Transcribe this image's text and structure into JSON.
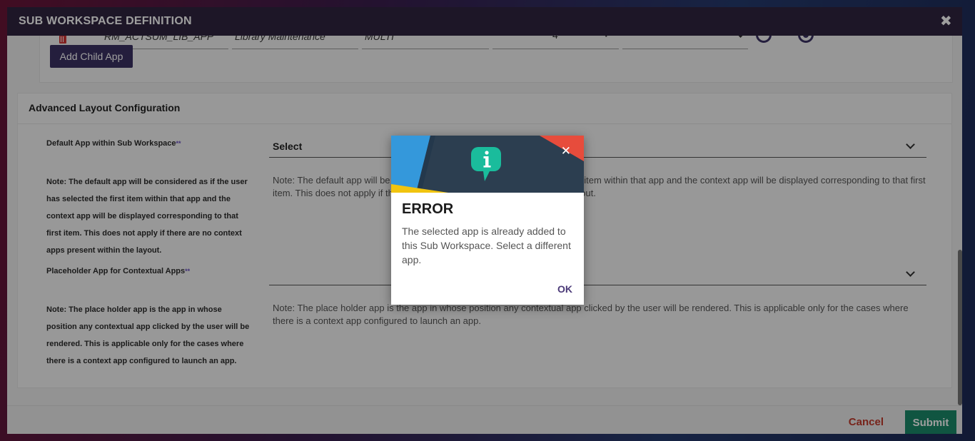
{
  "modal": {
    "title": "SUB WORKSPACE DEFINITION",
    "close_glyph": "✖"
  },
  "child_app_row": {
    "app_code": "RM_ACTSUM_LIB_APP",
    "app_name": "Library Maintenance",
    "mode": "MULTI",
    "minus": "−",
    "count": "4",
    "plus": "+"
  },
  "add_child_label": "Add Child App",
  "advanced": {
    "title": "Advanced Layout Configuration",
    "default_app_label": "Default App within Sub Workspace",
    "required_mark": "**",
    "default_app_side_note": "Note: The default app will be considered as if the user has selected the first item within that app and the context app will be displayed corresponding to that first item. This does not apply if there are no context apps present within the layout.",
    "default_app_select_value": "Select",
    "default_app_note": "Note: The default app will be considered as if the user has selected the first item within that app and the context app will be displayed corresponding to that first item. This does not apply if there are no context apps present within the layout.",
    "placeholder_label": "Placeholder App for Contextual Apps",
    "placeholder_side_note": "Note: The place holder app is the app in whose position any contextual app clicked by the user will be rendered. This is applicable only for the cases where there is a context app configured to launch an app.",
    "placeholder_select_value": "",
    "placeholder_note": "Note: The place holder app is the app in whose position any contextual app clicked by the user will be rendered. This is applicable only for the cases where there is a context app configured to launch an app."
  },
  "footer": {
    "cancel_label": "Cancel",
    "submit_label": "Submit"
  },
  "dialog": {
    "title": "ERROR",
    "message": "The selected app is already added to this Sub Workspace. Select a different app.",
    "ok_label": "OK",
    "close_glyph": "✕",
    "icon": "info-chat-icon",
    "colors": {
      "banner": "#2c3e50",
      "blue": "#3498db",
      "yellow": "#f1c40f",
      "red": "#e74c3c",
      "icon": "#1abc9c"
    }
  }
}
